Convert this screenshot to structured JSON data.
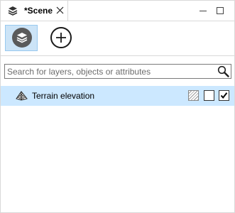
{
  "tab": {
    "title": "*Scene",
    "icon": "layers-icon",
    "close_icon": "close-icon"
  },
  "window": {
    "minimize_icon": "minimize-icon",
    "maximize_icon": "maximize-icon"
  },
  "toolbar": {
    "layers_button_icon": "layers-icon",
    "add_button_icon": "plus-icon"
  },
  "search": {
    "placeholder": "Search for layers, objects or attributes",
    "value": "",
    "icon": "search-icon"
  },
  "layers": [
    {
      "label": "Terrain elevation",
      "icon": "terrain-icon",
      "hatch_toggle": "hatched",
      "toggle_1_checked": false,
      "visible_checked": true
    }
  ],
  "colors": {
    "selected_row": "#cce8ff",
    "active_tool": "#cce4f7",
    "border": "#d9d9d9"
  }
}
